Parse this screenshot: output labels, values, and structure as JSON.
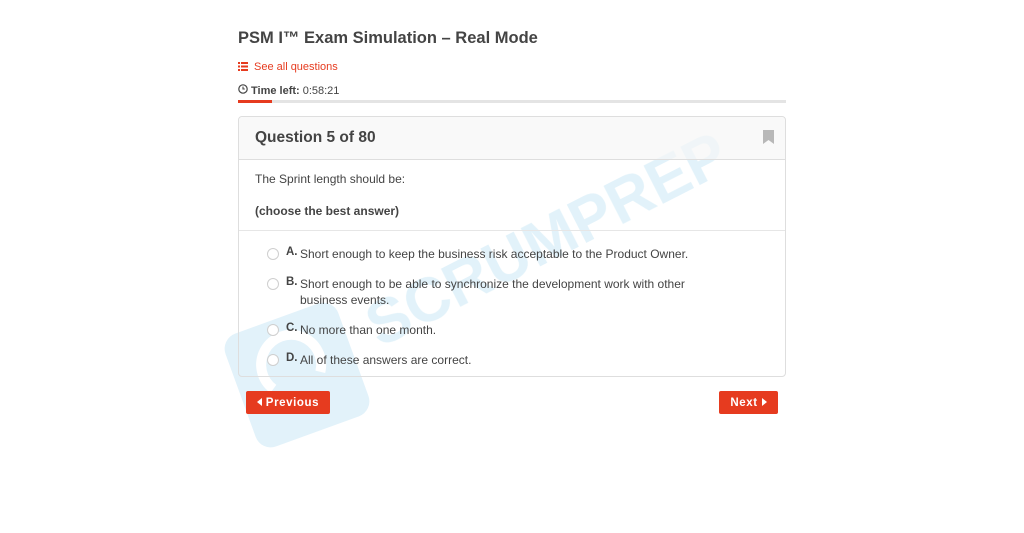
{
  "exam": {
    "title": "PSM I™ Exam Simulation – Real Mode",
    "see_all_label": "See all questions",
    "time_left_label": "Time left:",
    "time_left_value": "0:58:21",
    "progress_fraction": 0.0625
  },
  "question": {
    "number_label": "Question 5 of 80",
    "stem": "The Sprint length should be:",
    "instruction": "(choose the best answer)",
    "options": [
      {
        "letter": "A.",
        "text": "Short enough to keep the business risk acceptable to the Product Owner."
      },
      {
        "letter": "B.",
        "text": "Short enough to be able to synchronize the development work with other business events."
      },
      {
        "letter": "C.",
        "text": "No more than one month."
      },
      {
        "letter": "D.",
        "text": "All of these answers are correct."
      }
    ]
  },
  "nav": {
    "previous_label": "Previous",
    "next_label": "Next"
  },
  "watermark": {
    "text": "SCRUMPREP"
  },
  "icons": {
    "list": "list-icon",
    "clock": "clock-icon",
    "bookmark": "bookmark-icon",
    "caret_left": "caret-left-icon",
    "caret_right": "caret-right-icon"
  },
  "colors": {
    "accent": "#e63b1f",
    "watermark": "#bfe3f3"
  }
}
